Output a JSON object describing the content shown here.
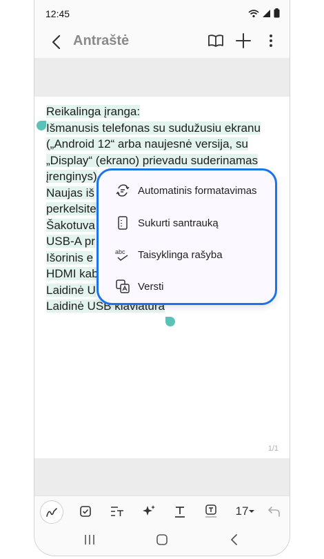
{
  "status": {
    "time": "12:45"
  },
  "header": {
    "title": "Antraštė"
  },
  "note": {
    "lines": [
      "Reikalinga įranga:",
      "Išmanusis telefonas su sudužusiu ekranu",
      "(„Android 12“ arba naujesnė versija, su",
      "„Display“ (ekrano) prievadu suderinamas",
      "įrenginys)",
      "Naujas iš",
      "perkelsite",
      "Šakotuva",
      "USB-A pr",
      "Išorinis e",
      "HDMI kab",
      "Laidinė U",
      "Laidinė USB klaviatūra"
    ],
    "page_indicator": "1/1"
  },
  "popup_menu": {
    "items": [
      {
        "label": "Automatinis formatavimas",
        "icon": "auto-format-icon"
      },
      {
        "label": "Sukurti santrauką",
        "icon": "summary-icon"
      },
      {
        "label": "Taisyklinga rašyba",
        "icon": "spell-check-icon"
      },
      {
        "label": "Versti",
        "icon": "translate-icon"
      }
    ]
  },
  "toolbar": {
    "font_size": "17"
  },
  "colors": {
    "accent": "#1a73e8",
    "highlight": "#e3f4ee",
    "handle": "#5bc2b8"
  }
}
